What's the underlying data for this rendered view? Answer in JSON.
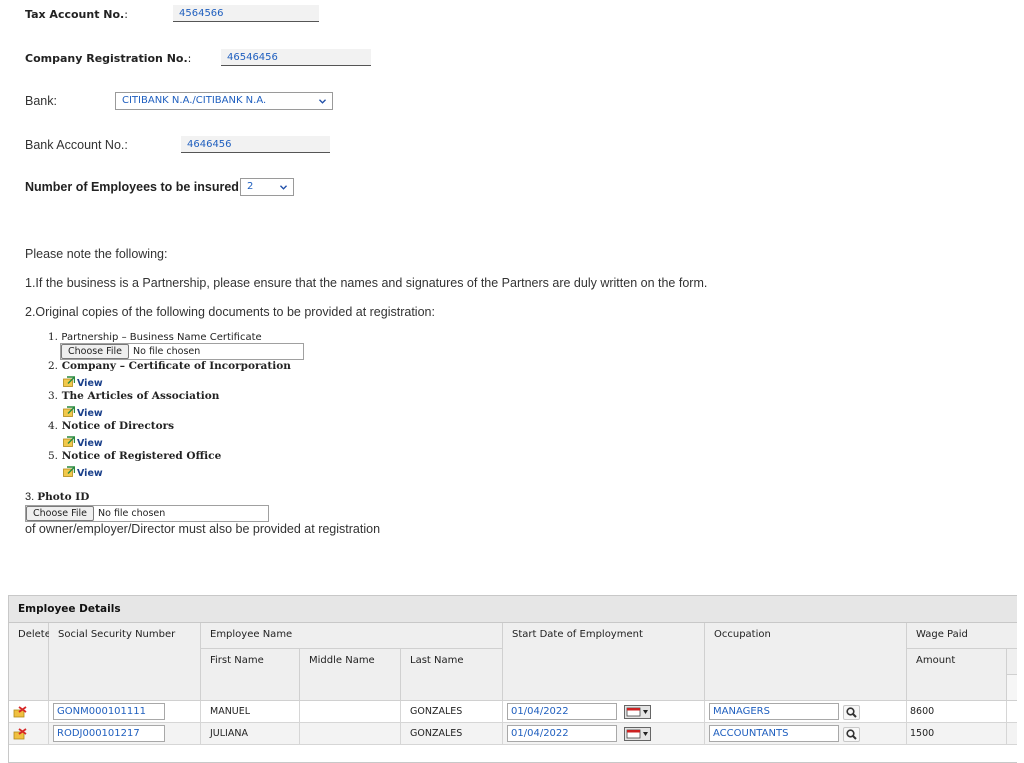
{
  "form": {
    "tax_label": "Tax Account No.",
    "tax_colon": ":",
    "tax_value": "4564566",
    "reg_label": "Company Registration No.",
    "reg_colon": ":",
    "reg_value": "46546456",
    "bank_label": "Bank:",
    "bank_value": "CITIBANK N.A./CITIBANK N.A.",
    "account_label": "Bank Account No.:",
    "account_value": "4646456",
    "employees_label": "Number of Employees to be insured:",
    "employees_value": "2"
  },
  "notes": {
    "intro": "Please note the following:",
    "note1": "1.If the business is a Partnership, please ensure that the names and signatures of the Partners are duly written on the form.",
    "note2": "2.Original copies of the following documents to be provided at registration:",
    "documents": [
      {
        "num": "1.",
        "label": "Partnership – Business Name Certificate"
      },
      {
        "num": "2.",
        "label": "Company – Certificate of Incorporation",
        "link": "View"
      },
      {
        "num": "3.",
        "label": "The Articles of Association",
        "link": "View"
      },
      {
        "num": "4.",
        "label": "Notice of Directors",
        "link": "View"
      },
      {
        "num": "5.",
        "label": "Notice of Registered Office",
        "link": "View"
      }
    ],
    "file_button": "Choose File",
    "file_status": "No file chosen",
    "note3_num": "3.",
    "note3_label": "Photo ID",
    "note3_tail": "of owner/employer/Director must also be provided at registration"
  },
  "table": {
    "title": "Employee Details",
    "headers": {
      "delete": "Delete",
      "ssn": "Social Security Number",
      "name": "Employee Name",
      "first": "First Name",
      "middle": "Middle Name",
      "last": "Last Name",
      "start": "Start Date of Employment",
      "occupation": "Occupation",
      "wage": "Wage Paid",
      "amount": "Amount"
    },
    "rows": [
      {
        "ssn": "GONM000101111",
        "first": "MANUEL",
        "middle": "",
        "last": "GONZALES",
        "start": "01/04/2022",
        "occupation": "MANAGERS",
        "amount": "8600"
      },
      {
        "ssn": "RODJ000101217",
        "first": "JULIANA",
        "middle": "",
        "last": "GONZALES",
        "start": "01/04/2022",
        "occupation": "ACCOUNTANTS",
        "amount": "1500"
      }
    ]
  },
  "colors": {
    "link": "#1f5fbf",
    "header_bg": "#efefef",
    "title_bg": "#e6e6e6"
  }
}
